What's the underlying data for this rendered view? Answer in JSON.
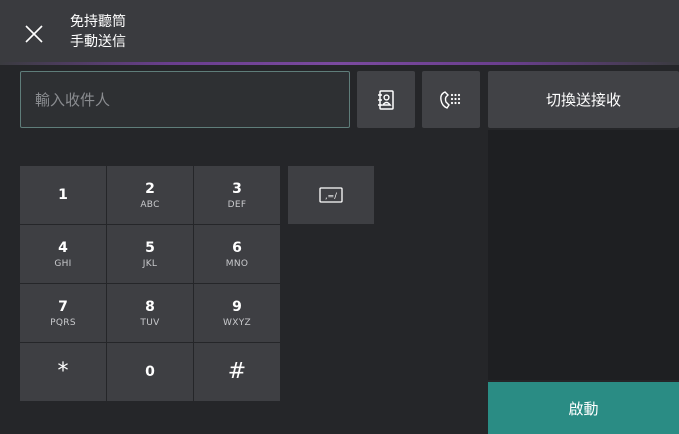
{
  "header": {
    "title_line1": "免持聽筒",
    "title_line2": "手動送信"
  },
  "recipient": {
    "placeholder": "輸入收件人"
  },
  "buttons": {
    "switch_label": "切換送接收",
    "start_label": "啟動"
  },
  "keypad": {
    "keys": [
      {
        "num": "1",
        "letters": ""
      },
      {
        "num": "2",
        "letters": "ABC"
      },
      {
        "num": "3",
        "letters": "DEF"
      },
      {
        "num": "4",
        "letters": "GHI"
      },
      {
        "num": "5",
        "letters": "JKL"
      },
      {
        "num": "6",
        "letters": "MNO"
      },
      {
        "num": "7",
        "letters": "PQRS"
      },
      {
        "num": "8",
        "letters": "TUV"
      },
      {
        "num": "9",
        "letters": "WXYZ"
      },
      {
        "num": "*",
        "letters": ""
      },
      {
        "num": "0",
        "letters": ""
      },
      {
        "num": "#",
        "letters": ""
      }
    ],
    "pause_symbol": ",=/"
  },
  "colors": {
    "background": "#252629",
    "header": "#3a3b3f",
    "accent_purple": "#7b4aa0",
    "key": "#3e3f43",
    "start": "#2a8c84"
  }
}
